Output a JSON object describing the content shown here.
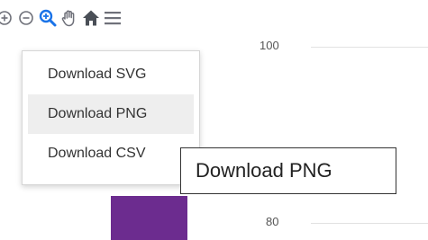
{
  "toolbar": {
    "icons": [
      "zoom-in-icon",
      "zoom-out-icon",
      "zoom-selection-icon",
      "pan-hand-icon",
      "home-reset-icon",
      "menu-hamburger-icon"
    ],
    "zoom_selection_active_color": "#1a73e8",
    "icon_color": "#6e7079"
  },
  "axis": {
    "y_ticks": [
      "100",
      "80"
    ]
  },
  "chart": {
    "bar_color": "#6c2c8f"
  },
  "menu": {
    "items": [
      {
        "label": "Download SVG"
      },
      {
        "label": "Download PNG",
        "hovered": true
      },
      {
        "label": "Download CSV"
      }
    ]
  },
  "tooltip": {
    "text": "Download PNG"
  }
}
